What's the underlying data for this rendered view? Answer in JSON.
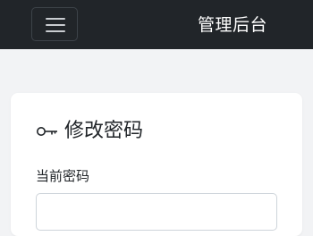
{
  "navbar": {
    "toggle_icon": "hamburger-menu-icon",
    "brand": "管理后台",
    "background": "#212529"
  },
  "card": {
    "icon": "key-icon",
    "title": "修改密码",
    "fields": [
      {
        "label": "当前密码",
        "value": "",
        "placeholder": ""
      }
    ]
  }
}
